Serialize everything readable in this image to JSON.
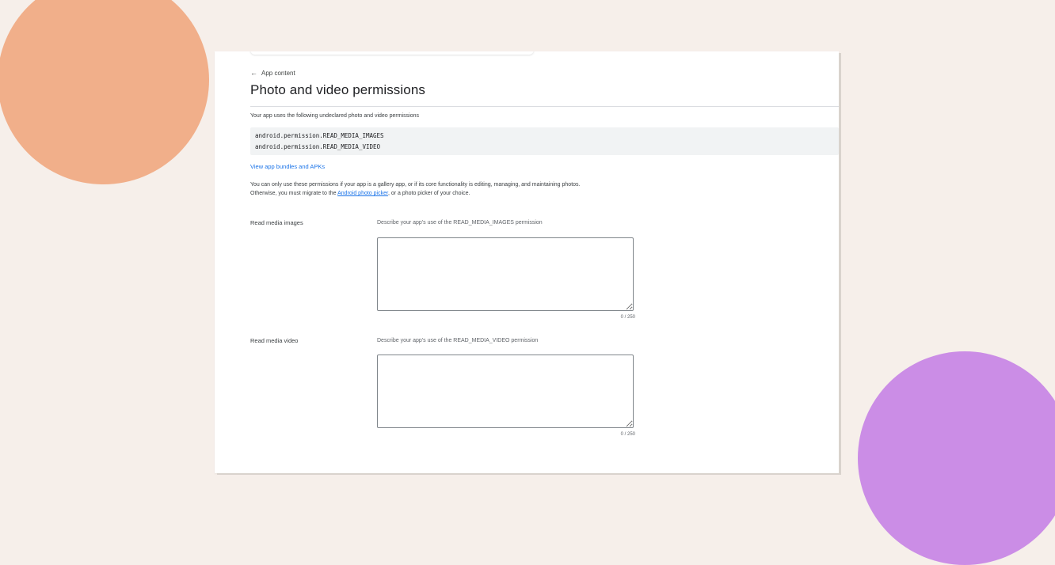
{
  "decor": {
    "accent_orange": "#f1af8a",
    "accent_purple": "#cb8de6",
    "background": "#f6efea"
  },
  "header": {
    "back_icon": "arrow-left-icon",
    "back_label": "App content",
    "title": "Photo and video permissions"
  },
  "intro_text": "Your app uses the following undeclared photo and video permissions",
  "permissions": [
    "android.permission.READ_MEDIA_IMAGES",
    "android.permission.READ_MEDIA_VIDEO"
  ],
  "view_link": "View app bundles and APKs",
  "policy": {
    "line1": "You can only use these permissions if your app is a gallery app, or if its core functionality is editing, managing, and maintaining photos.",
    "line2_before": "Otherwise, you must migrate to the ",
    "line2_link": "Android photo picker",
    "line2_after": ", or a photo picker of your choice."
  },
  "fields": [
    {
      "label": "Read media images",
      "description": "Describe your app's use of the READ_MEDIA_IMAGES permission",
      "value": "",
      "counter": "0 / 250"
    },
    {
      "label": "Read media video",
      "description": "Describe your app's use of the READ_MEDIA_VIDEO permission",
      "value": "",
      "counter": "0 / 250"
    }
  ],
  "colors": {
    "link": "#1a73e8",
    "code_background": "#f1f3f4"
  }
}
